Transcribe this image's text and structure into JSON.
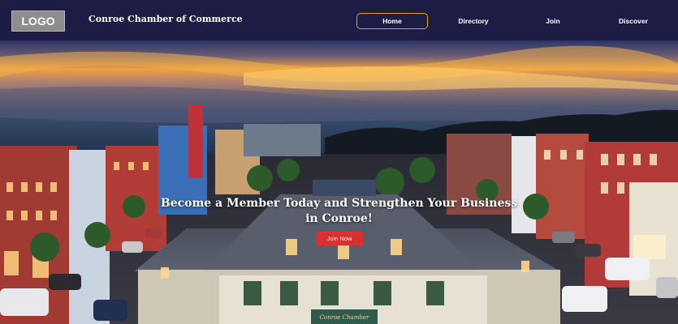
{
  "header": {
    "logo_text": "LOGO",
    "brand_name": "Conroe Chamber of Commerce",
    "nav": {
      "home": "Home",
      "directory": "Directory",
      "join": "Join",
      "discover": "Discover"
    },
    "active_color": "#e3a51c",
    "background_color": "#1d1c44"
  },
  "hero": {
    "title": "Become a Member Today and Strengthen Your Business in Conroe!",
    "cta_label": "Join Now",
    "cta_color": "#d93030",
    "sign_text": "Conroe Chamber"
  }
}
